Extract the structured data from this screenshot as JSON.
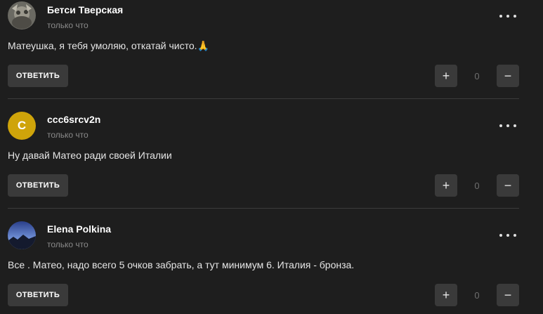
{
  "comments": [
    {
      "author": "Бетси Тверская",
      "time": "только что",
      "text": "Матеушка, я тебя умоляю, откатай чисто.🙏",
      "reply_label": "ответить",
      "score": "0",
      "avatar_type": "photo"
    },
    {
      "author": "ccc6srcv2n",
      "time": "только что",
      "text": "Ну давай Матео ради своей Италии",
      "reply_label": "ответить",
      "score": "0",
      "avatar_letter": "C",
      "avatar_color": "#cfa40a"
    },
    {
      "author": "Elena Polkina",
      "time": "только что",
      "text": "Все . Матео, надо всего 5 очков забрать, а тут минимум 6. Италия - бронза.",
      "reply_label": "ответить",
      "score": "0",
      "avatar_type": "photo"
    }
  ],
  "icons": {
    "plus": "+",
    "minus": "−"
  }
}
